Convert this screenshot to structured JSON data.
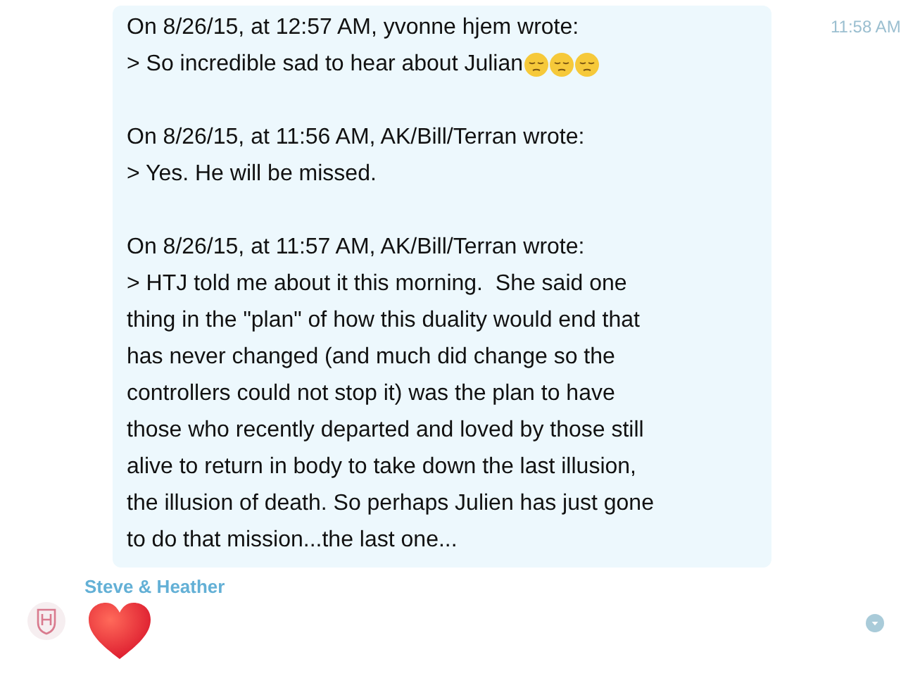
{
  "message": {
    "time": "11:58 AM",
    "paragraphs": [
      {
        "lines": [
          "On 8/26/15, at 12:57 AM, yvonne hjem wrote:",
          "> So incredible sad to hear about Julian"
        ],
        "emojis": [
          {
            "kind": "pensive"
          },
          {
            "kind": "pensive"
          },
          {
            "kind": "pensive"
          }
        ]
      },
      {
        "lines": [
          "On 8/26/15, at 11:56 AM, AK/Bill/Terran wrote:",
          "> Yes. He will be missed."
        ]
      },
      {
        "lines": [
          "On 8/26/15, at 11:57 AM, AK/Bill/Terran wrote:",
          "> HTJ told me about it this morning.  She said one",
          "thing in the \"plan\" of how this duality would end that",
          "has never changed (and much did change so the",
          "controllers could not stop it) was the plan to have",
          "those who recently departed and loved by those still",
          "alive to return in body to take down the last illusion,",
          "the illusion of death. So perhaps Julien has just gone",
          "to do that mission...the last one..."
        ]
      }
    ]
  },
  "reply": {
    "sender": "Steve & Heather",
    "content": {
      "kind": "heart"
    }
  }
}
